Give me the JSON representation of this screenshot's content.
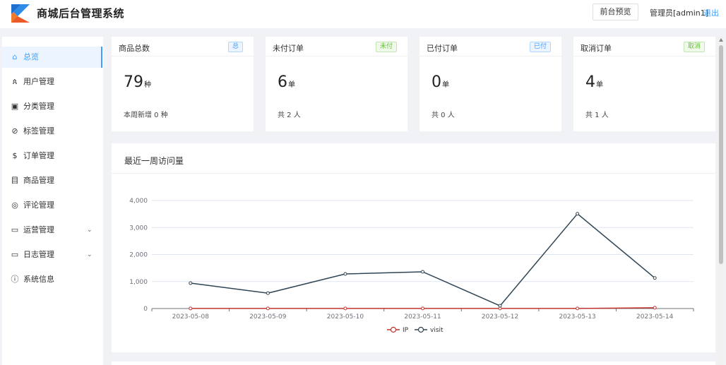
{
  "header": {
    "title": "商城后台管理系统",
    "preview_label": "前台预览",
    "admin_label": "管理员[admin1]",
    "logout_label": "退出"
  },
  "sidebar": {
    "items": [
      {
        "label": "总览",
        "icon": "home-icon",
        "glyph": "⌂",
        "active": true
      },
      {
        "label": "用户管理",
        "icon": "user-icon",
        "glyph": "ጰ"
      },
      {
        "label": "分类管理",
        "icon": "category-icon",
        "glyph": "▣"
      },
      {
        "label": "标签管理",
        "icon": "tag-icon",
        "glyph": "⊘"
      },
      {
        "label": "订单管理",
        "icon": "dollar-icon",
        "glyph": "$"
      },
      {
        "label": "商品管理",
        "icon": "goods-icon",
        "glyph": "目"
      },
      {
        "label": "评论管理",
        "icon": "comment-icon",
        "glyph": "◎"
      },
      {
        "label": "运营管理",
        "icon": "folder-icon",
        "glyph": "▭",
        "expandable": true
      },
      {
        "label": "日志管理",
        "icon": "folder-icon",
        "glyph": "▭",
        "expandable": true
      },
      {
        "label": "系统信息",
        "icon": "info-icon",
        "glyph": "ⓘ"
      }
    ]
  },
  "cards": [
    {
      "title": "商品总数",
      "badge": "总",
      "badge_color": "blue",
      "value": "79",
      "unit": "种",
      "footer": "本周新增 0 种"
    },
    {
      "title": "未付订单",
      "badge": "未付",
      "badge_color": "green",
      "value": "6",
      "unit": "单",
      "footer": "共 2 人"
    },
    {
      "title": "已付订单",
      "badge": "已付",
      "badge_color": "blue",
      "value": "0",
      "unit": "单",
      "footer": "共 0 人"
    },
    {
      "title": "取消订单",
      "badge": "取消",
      "badge_color": "green",
      "value": "4",
      "unit": "单",
      "footer": "共 1 人"
    }
  ],
  "chart_data": {
    "type": "line",
    "title": "最近一周访问量",
    "x": [
      "2023-05-08",
      "2023-05-09",
      "2023-05-10",
      "2023-05-11",
      "2023-05-12",
      "2023-05-13",
      "2023-05-14"
    ],
    "ylim": [
      0,
      4000
    ],
    "yticks": [
      0,
      1000,
      2000,
      3000,
      4000
    ],
    "ytick_labels": [
      "0",
      "1,000",
      "2,000",
      "3,000",
      "4,000"
    ],
    "grid": true,
    "legend": "bottom-center",
    "series": [
      {
        "name": "IP",
        "color": "#c23531",
        "values": [
          2,
          3,
          3,
          4,
          3,
          3,
          30
        ]
      },
      {
        "name": "visit",
        "color": "#2f4554",
        "values": [
          940,
          570,
          1280,
          1360,
          100,
          3510,
          1130
        ]
      }
    ]
  },
  "colors": {
    "accent": "#409eff",
    "success": "#67c23a"
  }
}
